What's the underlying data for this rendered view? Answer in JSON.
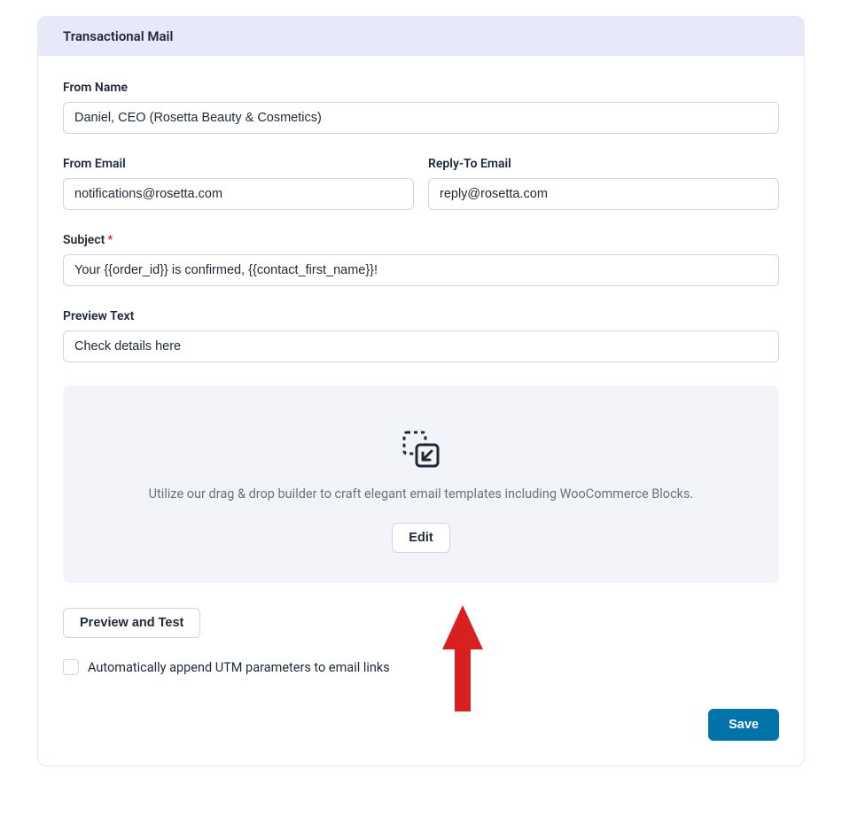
{
  "header": {
    "title": "Transactional Mail"
  },
  "fields": {
    "from_name": {
      "label": "From Name",
      "value": "Daniel, CEO (Rosetta Beauty & Cosmetics)"
    },
    "from_email": {
      "label": "From Email",
      "value": "notifications@rosetta.com"
    },
    "reply_to_email": {
      "label": "Reply-To Email",
      "value": "reply@rosetta.com"
    },
    "subject": {
      "label": "Subject",
      "required": true,
      "value": "Your {{order_id}} is confirmed, {{contact_first_name}}!"
    },
    "preview_text": {
      "label": "Preview Text",
      "value": "Check details here"
    }
  },
  "builder": {
    "description": "Utilize our drag & drop builder to craft elegant email templates including WooCommerce Blocks.",
    "edit_label": "Edit"
  },
  "actions": {
    "preview_test_label": "Preview and Test",
    "utm_checkbox_label": "Automatically append UTM parameters to email links",
    "save_label": "Save"
  }
}
